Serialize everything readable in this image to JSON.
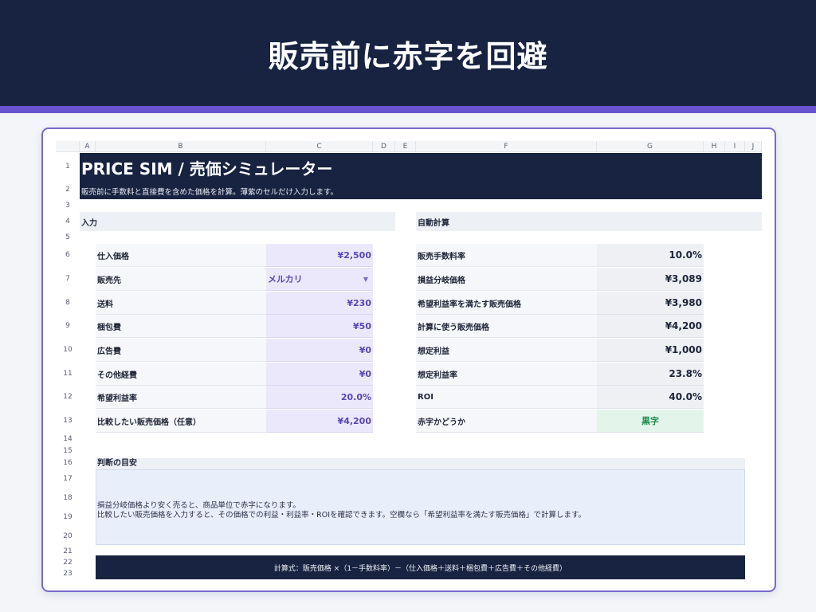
{
  "hero": {
    "title": "販売前に赤字を回避"
  },
  "colors": {
    "navy": "#172341",
    "accent": "#6a53cf",
    "input_bg": "#ece8fb",
    "ok_green": "#1f8a4c"
  },
  "sheet": {
    "columns": [
      "A",
      "B",
      "C",
      "D",
      "E",
      "F",
      "G",
      "H",
      "I",
      "J"
    ],
    "rows": [
      "1",
      "2",
      "3",
      "4",
      "5",
      "6",
      "7",
      "8",
      "9",
      "10",
      "11",
      "12",
      "13",
      "14",
      "15",
      "16",
      "17",
      "18",
      "19",
      "20",
      "21",
      "22",
      "23"
    ],
    "title": "PRICE SIM / 売価シミュレーター",
    "subtitle": "販売前に手数料と直接費を含めた価格を計算。薄紫のセルだけ入力します。",
    "input_section": "入力",
    "output_section": "自動計算",
    "inputs": [
      {
        "label": "仕入価格",
        "value": "¥2,500"
      },
      {
        "label": "販売先",
        "value": "メルカリ"
      },
      {
        "label": "送料",
        "value": "¥230"
      },
      {
        "label": "梱包費",
        "value": "¥50"
      },
      {
        "label": "広告費",
        "value": "¥0"
      },
      {
        "label": "その他経費",
        "value": "¥0"
      },
      {
        "label": "希望利益率",
        "value": "20.0%"
      },
      {
        "label": "比較したい販売価格（任意）",
        "value": "¥4,200"
      }
    ],
    "outputs": [
      {
        "label": "販売手数料率",
        "value": "10.0%"
      },
      {
        "label": "損益分岐価格",
        "value": "¥3,089"
      },
      {
        "label": "希望利益率を満たす販売価格",
        "value": "¥3,980"
      },
      {
        "label": "計算に使う販売価格",
        "value": "¥4,200"
      },
      {
        "label": "想定利益",
        "value": "¥1,000"
      },
      {
        "label": "想定利益率",
        "value": "23.8%"
      },
      {
        "label": "ROI",
        "value": "40.0%"
      },
      {
        "label": "赤字かどうか",
        "value": "黒字"
      }
    ],
    "guide_title": "判断の目安",
    "guide_lines": [
      "損益分岐価格より安く売ると、商品単位で赤字になります。",
      "比較したい販売価格を入力すると、その価格での利益・利益率・ROIを確認できます。空欄なら「希望利益率を満たす販売価格」で計算します。"
    ],
    "formula": "計算式：販売価格 ×（1－手数料率）－（仕入価格＋送料＋梱包費＋広告費＋その他経費）"
  }
}
